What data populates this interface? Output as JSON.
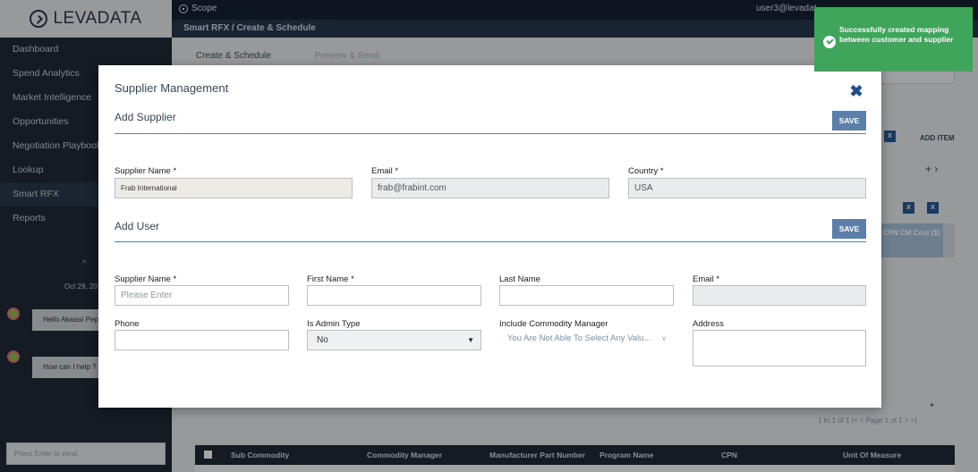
{
  "app": {
    "logo": "LEVADATA"
  },
  "sidebar": {
    "items": [
      {
        "label": "Dashboard"
      },
      {
        "label": "Spend Analytics"
      },
      {
        "label": "Market Intelligence"
      },
      {
        "label": "Opportunities"
      },
      {
        "label": "Negotiation Playbook"
      },
      {
        "label": "Lookup"
      },
      {
        "label": "Smart RFX"
      },
      {
        "label": "Reports"
      }
    ],
    "chat": {
      "date": "Oct 29, 20",
      "messages": [
        "Hello Akwasi Pep",
        "How can I help ?"
      ],
      "input_placeholder": "Press Enter to send"
    }
  },
  "topbar": {
    "scope_label": "Scope",
    "user_email": "user3@levadat"
  },
  "breadcrumb": "Smart RFX / Create & Schedule",
  "tabs": [
    {
      "label": "Create & Schedule"
    },
    {
      "label": "Preview & Send"
    }
  ],
  "background": {
    "add_item": "ADD ITEM",
    "cpn_header": "CPN CM Cost ($)",
    "pager": "1 to 1 of 1   |<  <  Page 1 of 1  >  >|",
    "grid2_columns": [
      "Sub Commodity",
      "Commodity Manager",
      "Manufacturer Part Number",
      "Program Name",
      "CPN",
      "Unit Of Measure"
    ]
  },
  "modal": {
    "title": "Supplier Management",
    "close_icon": "close-icon",
    "add_supplier": {
      "title": "Add Supplier",
      "save_label": "SAVE",
      "supplier_name_label": "Supplier Name *",
      "supplier_name_value": "Frab International",
      "email_label": "Email *",
      "email_value": "frab@frabint.com",
      "country_label": "Country *",
      "country_value": "USA"
    },
    "add_user": {
      "title": "Add User",
      "save_label": "SAVE",
      "supplier_name_label": "Supplier Name *",
      "supplier_name_placeholder": "Please Enter",
      "first_name_label": "First Name *",
      "last_name_label": "Last Name",
      "email_label": "Email *",
      "phone_label": "Phone",
      "is_admin_label": "Is Admin Type",
      "is_admin_value": "No",
      "commodity_manager_label": "Include Commodity Manager",
      "commodity_manager_value": "You Are Not Able To Select Any Valu...",
      "address_label": "Address"
    }
  },
  "toast": {
    "message": "Successfully created mapping between customer and supplier",
    "color": "#3fa55a",
    "icon": "check-circle-icon"
  }
}
